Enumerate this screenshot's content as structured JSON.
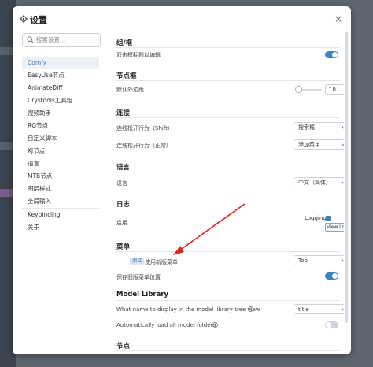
{
  "dialog": {
    "title": "设置",
    "close_glyph": "×"
  },
  "sidebar": {
    "search_placeholder": "搜索设置...",
    "items": [
      {
        "label": "Comfy"
      },
      {
        "label": "EasyUse节点"
      },
      {
        "label": "AnimateDiff"
      },
      {
        "label": "Crystools工具组"
      },
      {
        "label": "视频助手"
      },
      {
        "label": "RG节点"
      },
      {
        "label": "自定义脚本"
      },
      {
        "label": "KJ节点"
      },
      {
        "label": "语言"
      },
      {
        "label": "MTB节点"
      },
      {
        "label": "图层样式"
      },
      {
        "label": "全局输入"
      },
      {
        "label": "Keybinding"
      },
      {
        "label": "关于"
      }
    ]
  },
  "sections": {
    "group": {
      "title": "组/框",
      "rows": [
        {
          "label": "双击框标题以编辑",
          "toggle": true
        }
      ]
    },
    "node_frame": {
      "title": "节点框",
      "rows": [
        {
          "label": "默认外边距",
          "value": "10"
        }
      ]
    },
    "link": {
      "title": "连接",
      "rows": [
        {
          "label": "连线松开行为（Shift）",
          "value": "搜索框"
        },
        {
          "label": "连线松开行为（正常）",
          "value": "添加菜单"
        }
      ]
    },
    "language": {
      "title": "语言",
      "rows": [
        {
          "label": "语言",
          "value": "中文（简体）"
        }
      ]
    },
    "log": {
      "title": "日志",
      "rows": [
        {
          "label": "启用",
          "logging_label": "Logging",
          "button": "View Logs"
        }
      ]
    },
    "menu": {
      "title": "菜单",
      "rows": [
        {
          "badge": "测试",
          "label": "使用新版菜单",
          "value": "Top"
        },
        {
          "label": "保存旧版菜单位置",
          "toggle": true
        }
      ]
    },
    "model_library": {
      "title": "Model Library",
      "rows": [
        {
          "label": "What name to display in the model library tree view",
          "value": "title"
        },
        {
          "label": "Automatically load all model folders",
          "toggle": false
        }
      ]
    },
    "node": {
      "title": "节点"
    }
  },
  "colors": {
    "accent": "#3b82c4",
    "annotation_arrow": "#e02424"
  },
  "icons": {
    "header": "gear-icon",
    "search": "search-icon",
    "select": "chevron-down-icon",
    "info": "info-icon"
  }
}
